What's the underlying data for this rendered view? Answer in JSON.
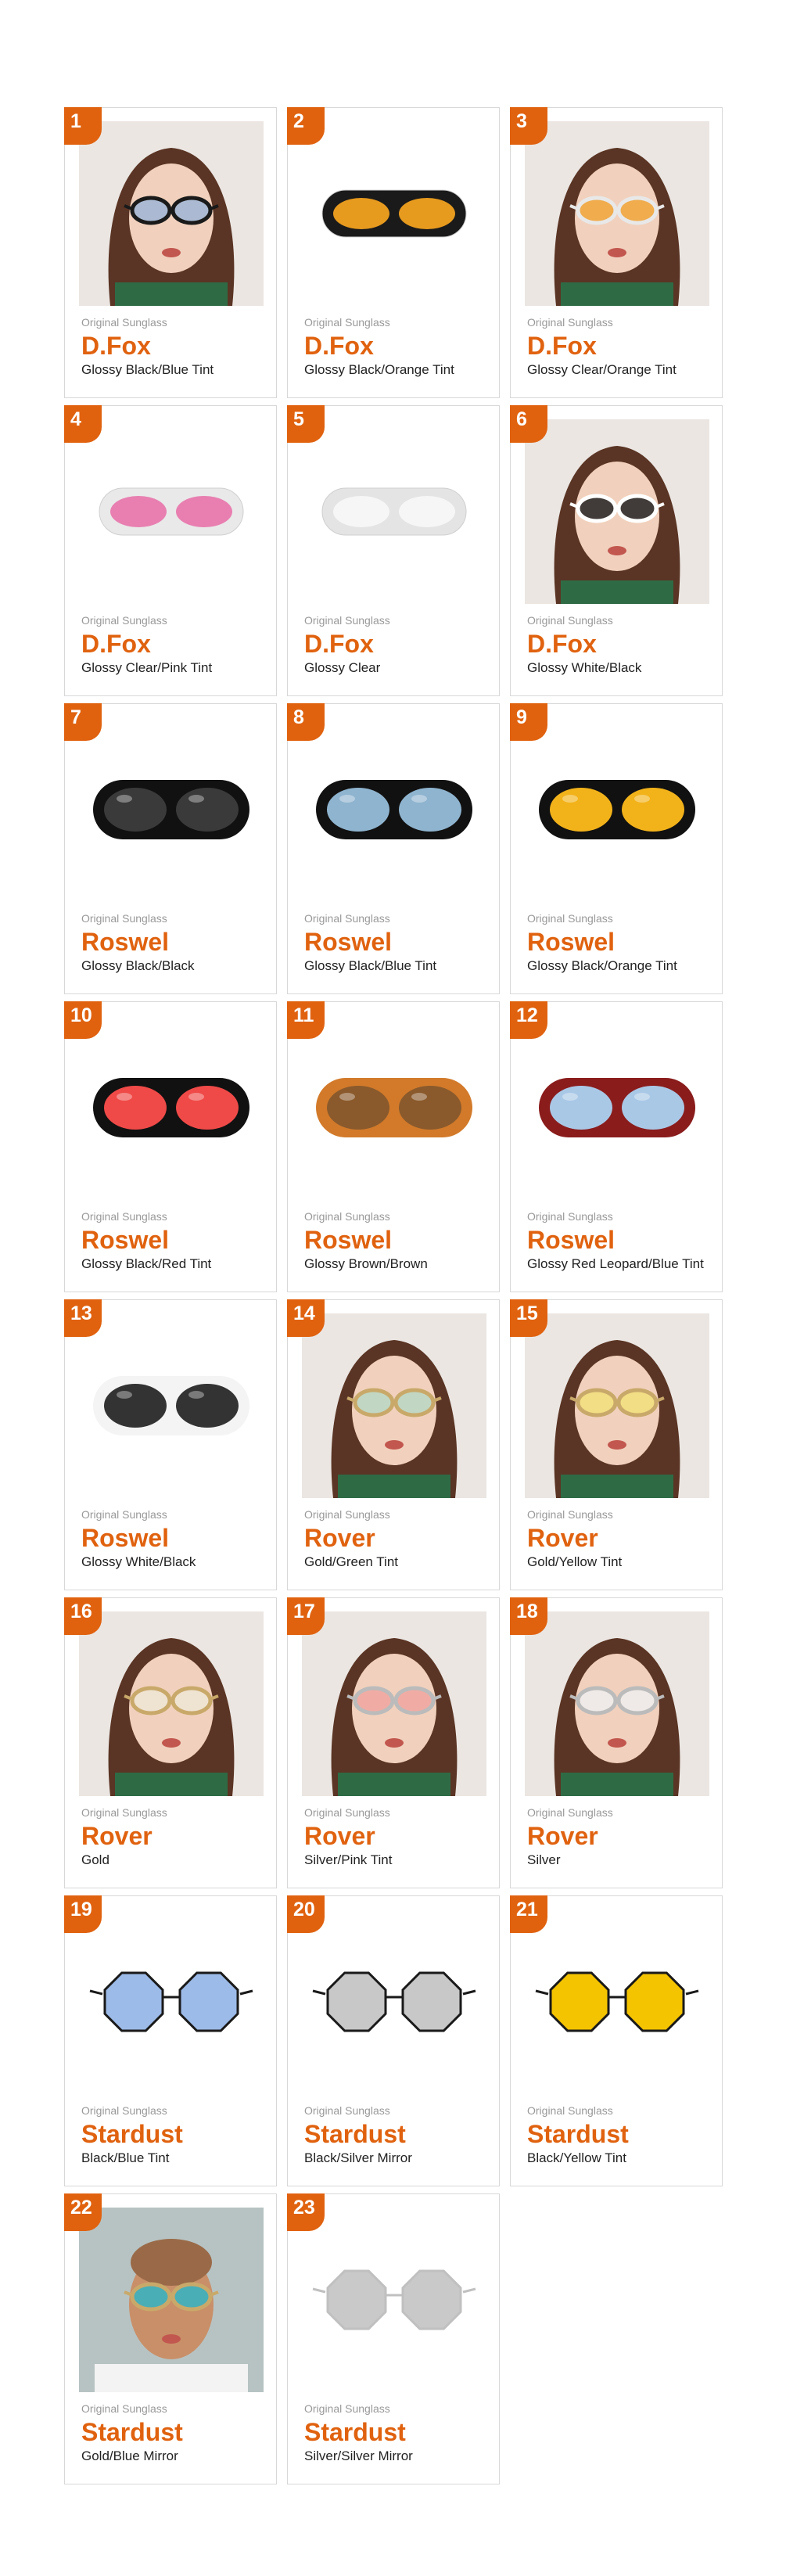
{
  "products": [
    {
      "number": "1",
      "subtitle": "Original Sunglass",
      "name": "D.Fox",
      "variant": "Glossy Black/Blue Tint",
      "image": "model-photo",
      "frame": "#1a1a1a",
      "lens": "#9fb6d6"
    },
    {
      "number": "2",
      "subtitle": "Original Sunglass",
      "name": "D.Fox",
      "variant": "Glossy Black/Orange Tint",
      "image": "product-photo",
      "shape": "cat",
      "frame": "#1a1a1a",
      "lens": "#e69a1e"
    },
    {
      "number": "3",
      "subtitle": "Original Sunglass",
      "name": "D.Fox",
      "variant": "Glossy Clear/Orange Tint",
      "image": "model-photo",
      "frame": "#e8e8e8",
      "lens": "#f0a63a"
    },
    {
      "number": "4",
      "subtitle": "Original Sunglass",
      "name": "D.Fox",
      "variant": "Glossy Clear/Pink Tint",
      "image": "product-photo",
      "shape": "cat",
      "frame": "#e9e9e9",
      "lens": "#e87fb0"
    },
    {
      "number": "5",
      "subtitle": "Original Sunglass",
      "name": "D.Fox",
      "variant": "Glossy Clear",
      "image": "product-photo",
      "shape": "cat",
      "frame": "#e4e4e4",
      "lens": "#f6f6f6"
    },
    {
      "number": "6",
      "subtitle": "Original Sunglass",
      "name": "D.Fox",
      "variant": "Glossy White/Black",
      "image": "model-photo",
      "frame": "#ffffff",
      "lens": "#222222"
    },
    {
      "number": "7",
      "subtitle": "Original Sunglass",
      "name": "Roswel",
      "variant": "Glossy Black/Black",
      "image": "product-photo",
      "shape": "oval",
      "frame": "#111111",
      "lens": "#3a3a3a"
    },
    {
      "number": "8",
      "subtitle": "Original Sunglass",
      "name": "Roswel",
      "variant": "Glossy Black/Blue Tint",
      "image": "product-photo",
      "shape": "oval",
      "frame": "#111111",
      "lens": "#8fb4cf"
    },
    {
      "number": "9",
      "subtitle": "Original Sunglass",
      "name": "Roswel",
      "variant": "Glossy Black/Orange Tint",
      "image": "product-photo",
      "shape": "oval",
      "frame": "#111111",
      "lens": "#f2b21a"
    },
    {
      "number": "10",
      "subtitle": "Original Sunglass",
      "name": "Roswel",
      "variant": "Glossy Black/Red Tint",
      "image": "product-photo",
      "shape": "oval",
      "frame": "#111111",
      "lens": "#ef4a48"
    },
    {
      "number": "11",
      "subtitle": "Original Sunglass",
      "name": "Roswel",
      "variant": "Glossy Brown/Brown",
      "image": "product-photo",
      "shape": "oval",
      "frame": "#d27a2a",
      "lens": "#8a5a2c"
    },
    {
      "number": "12",
      "subtitle": "Original Sunglass",
      "name": "Roswel",
      "variant": "Glossy Red Leopard/Blue Tint",
      "image": "product-photo",
      "shape": "oval",
      "frame": "#8a1c1c",
      "lens": "#a9c8e6"
    },
    {
      "number": "13",
      "subtitle": "Original Sunglass",
      "name": "Roswel",
      "variant": "Glossy White/Black",
      "image": "product-photo",
      "shape": "oval",
      "frame": "#f4f4f4",
      "lens": "#333333"
    },
    {
      "number": "14",
      "subtitle": "Original Sunglass",
      "name": "Rover",
      "variant": "Gold/Green Tint",
      "image": "model-photo",
      "frame": "#c9a96a",
      "lens": "#b9d8c4"
    },
    {
      "number": "15",
      "subtitle": "Original Sunglass",
      "name": "Rover",
      "variant": "Gold/Yellow Tint",
      "image": "model-photo",
      "frame": "#c9a96a",
      "lens": "#f2e07a"
    },
    {
      "number": "16",
      "subtitle": "Original Sunglass",
      "name": "Rover",
      "variant": "Gold",
      "image": "model-photo",
      "frame": "#c9a96a",
      "lens": "#efe6d6"
    },
    {
      "number": "17",
      "subtitle": "Original Sunglass",
      "name": "Rover",
      "variant": "Silver/Pink Tint",
      "image": "model-photo",
      "frame": "#bbbbbb",
      "lens": "#f0a6a0"
    },
    {
      "number": "18",
      "subtitle": "Original Sunglass",
      "name": "Rover",
      "variant": "Silver",
      "image": "model-photo",
      "frame": "#bbbbbb",
      "lens": "#eeeeee"
    },
    {
      "number": "19",
      "subtitle": "Original Sunglass",
      "name": "Stardust",
      "variant": "Black/Blue Tint",
      "image": "product-photo",
      "shape": "octa",
      "frame": "#1a1a1a",
      "lens": "#9dbbe8"
    },
    {
      "number": "20",
      "subtitle": "Original Sunglass",
      "name": "Stardust",
      "variant": "Black/Silver Mirror",
      "image": "product-photo",
      "shape": "octa",
      "frame": "#1a1a1a",
      "lens": "#c8c8c8"
    },
    {
      "number": "21",
      "subtitle": "Original Sunglass",
      "name": "Stardust",
      "variant": "Black/Yellow Tint",
      "image": "product-photo",
      "shape": "octa",
      "frame": "#1a1a1a",
      "lens": "#f5c400"
    },
    {
      "number": "22",
      "subtitle": "Original Sunglass",
      "name": "Stardust",
      "variant": "Gold/Blue Mirror",
      "image": "model-photo-male",
      "frame": "#c9a96a",
      "lens": "#33b4c4"
    },
    {
      "number": "23",
      "subtitle": "Original Sunglass",
      "name": "Stardust",
      "variant": "Silver/Silver Mirror",
      "image": "product-photo",
      "shape": "octa",
      "frame": "#c0c0c0",
      "lens": "#c9c9c9"
    }
  ]
}
